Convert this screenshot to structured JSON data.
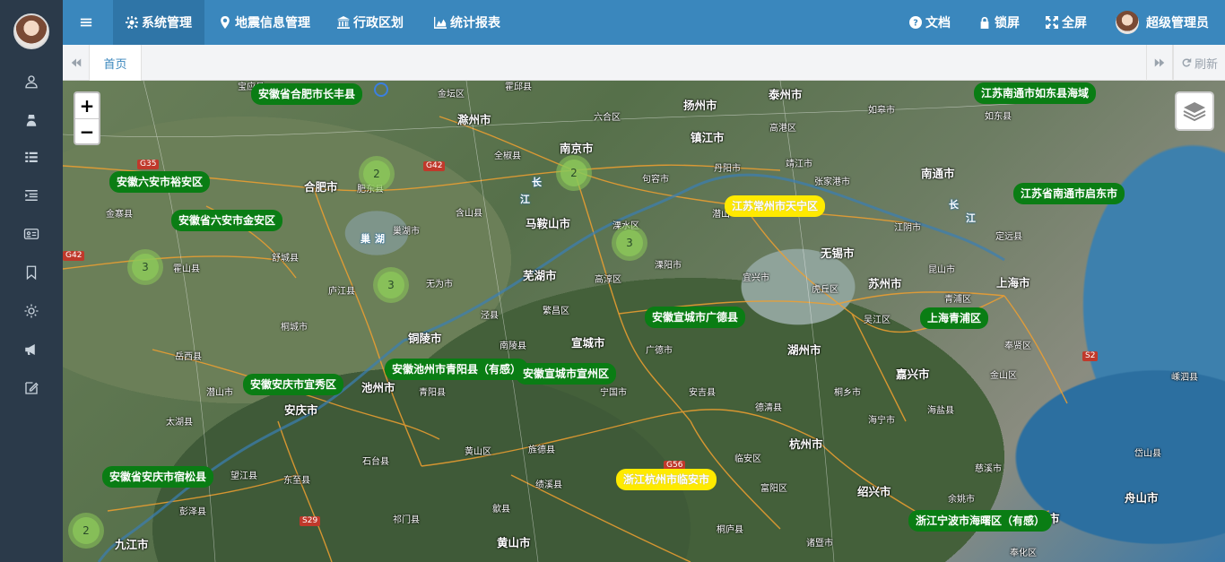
{
  "topbar": {
    "menu": [
      {
        "label": "系统管理",
        "icon": "gear-icon",
        "active": true
      },
      {
        "label": "地震信息管理",
        "icon": "map-marker-icon"
      },
      {
        "label": "行政区划",
        "icon": "bank-icon"
      },
      {
        "label": "统计报表",
        "icon": "area-chart-icon"
      }
    ],
    "right": {
      "docs": "文档",
      "lock": "锁屏",
      "fullscreen": "全屏",
      "user": "超级管理员"
    }
  },
  "tabs": {
    "home": "首页",
    "refresh": "刷新"
  },
  "map": {
    "zoom_in": "+",
    "zoom_out": "−",
    "labels": [
      {
        "text": "安徽省合肥市长丰县",
        "color": "green"
      },
      {
        "text": "江苏南通市如东县海域",
        "color": "green"
      },
      {
        "text": "安徽六安市裕安区",
        "color": "green"
      },
      {
        "text": "安徽省六安市金安区",
        "color": "green"
      },
      {
        "text": "江苏常州市天宁区",
        "color": "yellow"
      },
      {
        "text": "江苏省南通市启东市",
        "color": "green"
      },
      {
        "text": "安徽宣城市广德县",
        "color": "green"
      },
      {
        "text": "上海青浦区",
        "color": "green"
      },
      {
        "text": "安徽池州市青阳县（有感）",
        "color": "green"
      },
      {
        "text": "安徽宣城市宣州区",
        "color": "green"
      },
      {
        "text": "安徽安庆市宜秀区",
        "color": "green"
      },
      {
        "text": "安徽省安庆市宿松县",
        "color": "green"
      },
      {
        "text": "浙江杭州市临安市",
        "color": "yellow"
      },
      {
        "text": "浙江宁波市海曙区（有感）",
        "color": "green"
      }
    ],
    "clusters": [
      "2",
      "2",
      "3",
      "3",
      "3",
      "2"
    ],
    "cities": [
      "滁州市",
      "六合区",
      "南京市",
      "扬州市",
      "泰州市",
      "镇江市",
      "高港区",
      "如皋市",
      "如东县",
      "合肥市",
      "肥东县",
      "全椒县",
      "句容市",
      "丹阳市",
      "靖江市",
      "张家港市",
      "南通市",
      "金寨县",
      "含山县",
      "马鞍山市",
      "溧水区",
      "常州市",
      "江阴市",
      "巢湖市",
      "舒城县",
      "霍山县",
      "芜湖市",
      "无为市",
      "高淳区",
      "溧阳市",
      "宜兴市",
      "无锡市",
      "苏州市",
      "昆山市",
      "上海市",
      "庐江县",
      "泾县",
      "繁昌区",
      "郎溪县",
      "虎丘区",
      "青浦区",
      "吴江区",
      "铜陵市",
      "南陵县",
      "宣城市",
      "广德市",
      "湖州市",
      "奉贤区",
      "桐城市",
      "岳西县",
      "潜山市",
      "池州市",
      "青阳县",
      "宁国市",
      "安吉县",
      "德清县",
      "桐乡市",
      "嘉兴市",
      "金山区",
      "安庆市",
      "太湖县",
      "黄山区",
      "旌德县",
      "临安区",
      "杭州市",
      "海宁市",
      "海盐县",
      "望江县",
      "东至县",
      "石台县",
      "绩溪县",
      "歙县",
      "富阳区",
      "绍兴市",
      "余姚市",
      "慈溪市",
      "宁波市",
      "舟山市",
      "岱山县",
      "嵊泗县",
      "宿松县",
      "彭泽县",
      "九江市",
      "祁门县",
      "黄山市",
      "桐庐县",
      "诸暨市",
      "淳安县",
      "奉化区",
      "启东市",
      "崇明区",
      "寿县",
      "定远县",
      "来安县",
      "天长市",
      "宝应县",
      "金坛区",
      "霍邱县",
      "肥西县",
      "潜山"
    ],
    "rivers": [
      "长",
      "江",
      "长",
      "江",
      "巢",
      "湖"
    ],
    "highways": [
      "G35",
      "G42",
      "G42",
      "S2",
      "G56",
      "S29"
    ]
  }
}
